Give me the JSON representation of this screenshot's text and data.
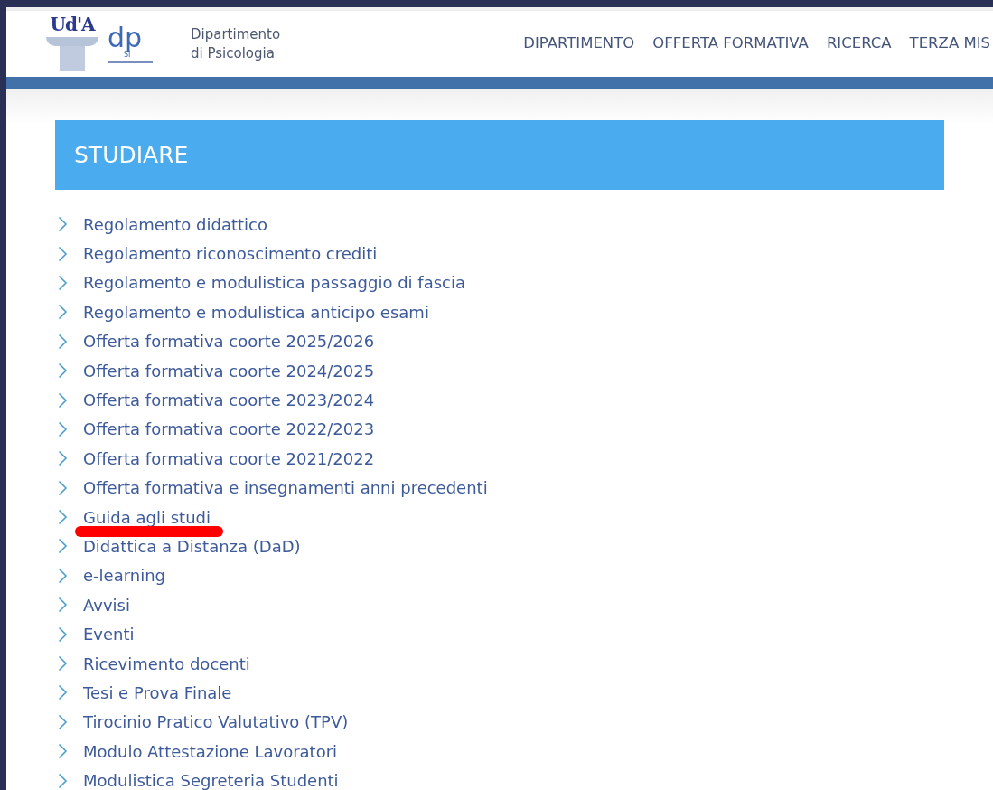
{
  "logo": {
    "university_mark": "Ud'A",
    "department_mark": "dp",
    "department_mark_sub": "SI"
  },
  "site_title": [
    "Dipartimento",
    "di Psicologia"
  ],
  "nav": [
    {
      "label": "DIPARTIMENTO"
    },
    {
      "label": "OFFERTA FORMATIVA"
    },
    {
      "label": "RICERCA"
    },
    {
      "label": "TERZA MIS"
    }
  ],
  "section": {
    "title": "STUDIARE",
    "items": [
      {
        "label": "Regolamento didattico",
        "underlined": false
      },
      {
        "label": "Regolamento riconoscimento crediti",
        "underlined": false
      },
      {
        "label": "Regolamento e modulistica passaggio di fascia",
        "underlined": false
      },
      {
        "label": "Regolamento e modulistica anticipo esami",
        "underlined": false
      },
      {
        "label": "Offerta formativa coorte 2025/2026",
        "underlined": false
      },
      {
        "label": "Offerta formativa coorte 2024/2025",
        "underlined": false
      },
      {
        "label": "Offerta formativa coorte 2023/2024",
        "underlined": false
      },
      {
        "label": "Offerta formativa coorte 2022/2023",
        "underlined": false
      },
      {
        "label": "Offerta formativa coorte 2021/2022",
        "underlined": false
      },
      {
        "label": "Offerta formativa e insegnamenti anni precedenti",
        "underlined": false
      },
      {
        "label": "Guida agli studi",
        "underlined": true
      },
      {
        "label": "Didattica a Distanza (DaD)",
        "underlined": false
      },
      {
        "label": "e-learning",
        "underlined": false
      },
      {
        "label": "Avvisi",
        "underlined": false
      },
      {
        "label": "Eventi",
        "underlined": false
      },
      {
        "label": "Ricevimento docenti",
        "underlined": false
      },
      {
        "label": "Tesi e Prova Finale",
        "underlined": false
      },
      {
        "label": "Tirocinio Pratico Valutativo (TPV)",
        "underlined": false
      },
      {
        "label": "Modulo Attestazione Lavoratori",
        "underlined": false
      },
      {
        "label": "Modulistica Segreteria Studenti",
        "underlined": false
      }
    ]
  }
}
